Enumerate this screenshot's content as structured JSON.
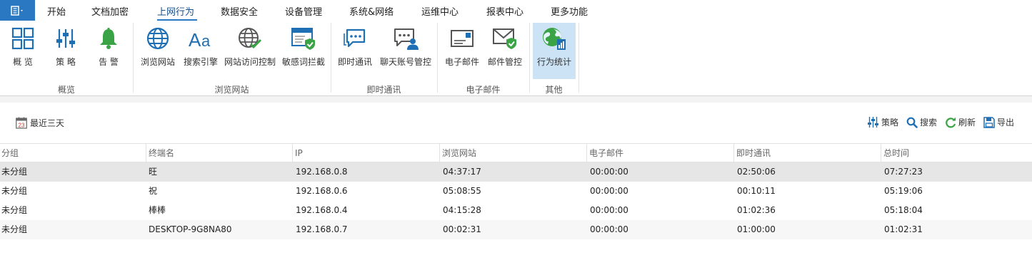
{
  "menu": {
    "tabs": [
      "开始",
      "文档加密",
      "上网行为",
      "数据安全",
      "设备管理",
      "系统&网络",
      "运维中心",
      "报表中心",
      "更多功能"
    ],
    "active_tab": "上网行为"
  },
  "ribbon": {
    "buttons": [
      {
        "label": "概 览",
        "icon": "grid-icon"
      },
      {
        "label": "策 略",
        "icon": "sliders-icon"
      },
      {
        "label": "告 警",
        "icon": "bell-icon"
      },
      {
        "label": "浏览网站",
        "icon": "globe-icon"
      },
      {
        "label": "搜索引擎",
        "icon": "font-aa-icon"
      },
      {
        "label": "网站访问控制",
        "icon": "globe-check-icon"
      },
      {
        "label": "敏感词拦截",
        "icon": "browser-shield-icon"
      },
      {
        "label": "即时通讯",
        "icon": "chat-icon"
      },
      {
        "label": "聊天账号管控",
        "icon": "chat-user-icon"
      },
      {
        "label": "电子邮件",
        "icon": "mail-card-icon"
      },
      {
        "label": "邮件管控",
        "icon": "mail-shield-icon"
      },
      {
        "label": "行为统计",
        "icon": "globe-stats-icon"
      }
    ],
    "selected": "行为统计",
    "groups": [
      "概览",
      "浏览网站",
      "即时通讯",
      "电子邮件",
      "其他"
    ]
  },
  "toolbar": {
    "date_filter": "最近三天",
    "calendar_day": "23",
    "actions": [
      {
        "label": "策略",
        "icon": "sliders-icon"
      },
      {
        "label": "搜索",
        "icon": "search-icon"
      },
      {
        "label": "刷新",
        "icon": "refresh-icon"
      },
      {
        "label": "导出",
        "icon": "save-icon"
      }
    ]
  },
  "table": {
    "columns": [
      "分组",
      "终端名",
      "IP",
      "浏览网站",
      "电子邮件",
      "即时通讯",
      "总时间"
    ],
    "rows": [
      [
        "未分组",
        "旺",
        "192.168.0.8",
        "04:37:17",
        "00:00:00",
        "02:50:06",
        "07:27:23"
      ],
      [
        "未分组",
        "祝",
        "192.168.0.6",
        "05:08:55",
        "00:00:00",
        "00:10:11",
        "05:19:06"
      ],
      [
        "未分组",
        "棒棒",
        "192.168.0.4",
        "04:15:28",
        "00:00:00",
        "01:02:36",
        "05:18:04"
      ],
      [
        "未分组",
        "DESKTOP-9G8NA80",
        "192.168.0.7",
        "00:02:31",
        "00:00:00",
        "01:00:00",
        "01:02:31"
      ]
    ],
    "selected_row": 0
  },
  "colors": {
    "accent": "#2b78c2",
    "icon_blue": "#1f6fb5",
    "icon_green": "#3aa345",
    "selected_button_bg": "#cce3f6",
    "selected_row_bg": "#e6e6e6"
  }
}
